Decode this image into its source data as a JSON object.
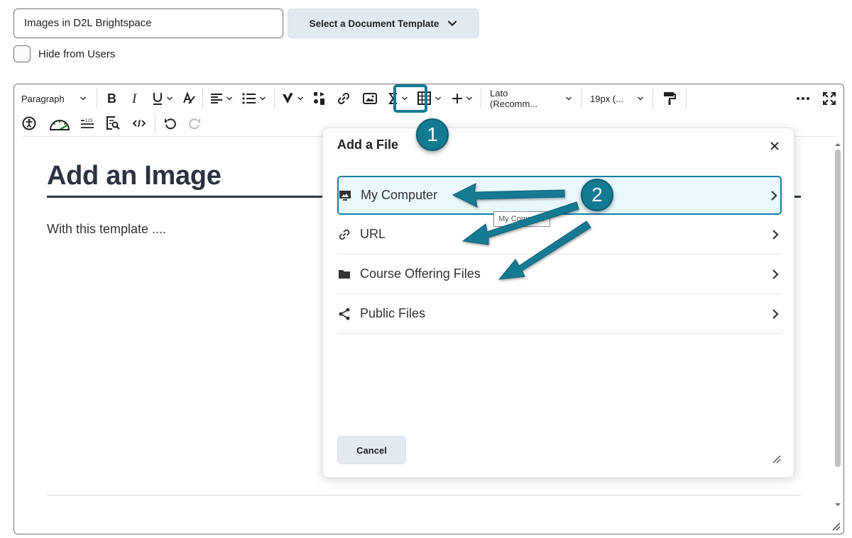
{
  "title_field": {
    "value": "Images in D2L Brightspace"
  },
  "template_button": {
    "label": "Select a Document Template"
  },
  "hide_checkbox": {
    "label": "Hide from Users",
    "checked": false
  },
  "toolbar": {
    "paragraph": "Paragraph",
    "font": "Lato (Recomm...",
    "font_size": "19px (..."
  },
  "content": {
    "heading": "Add an Image",
    "body": "With this template ...."
  },
  "dialog": {
    "title": "Add a File",
    "items": [
      {
        "label": "My Computer",
        "icon": "computer-icon",
        "selected": true
      },
      {
        "label": "URL",
        "icon": "link-icon",
        "selected": false
      },
      {
        "label": "Course Offering Files",
        "icon": "folder-icon",
        "selected": false
      },
      {
        "label": "Public Files",
        "icon": "share-icon",
        "selected": false
      }
    ],
    "tooltip": "My Computer",
    "cancel_label": "Cancel"
  },
  "callouts": {
    "first": "1",
    "second": "2"
  },
  "colors": {
    "accent": "#137a93",
    "selected_bg": "#e8f8fd",
    "button_bg": "#e3e9f1"
  }
}
